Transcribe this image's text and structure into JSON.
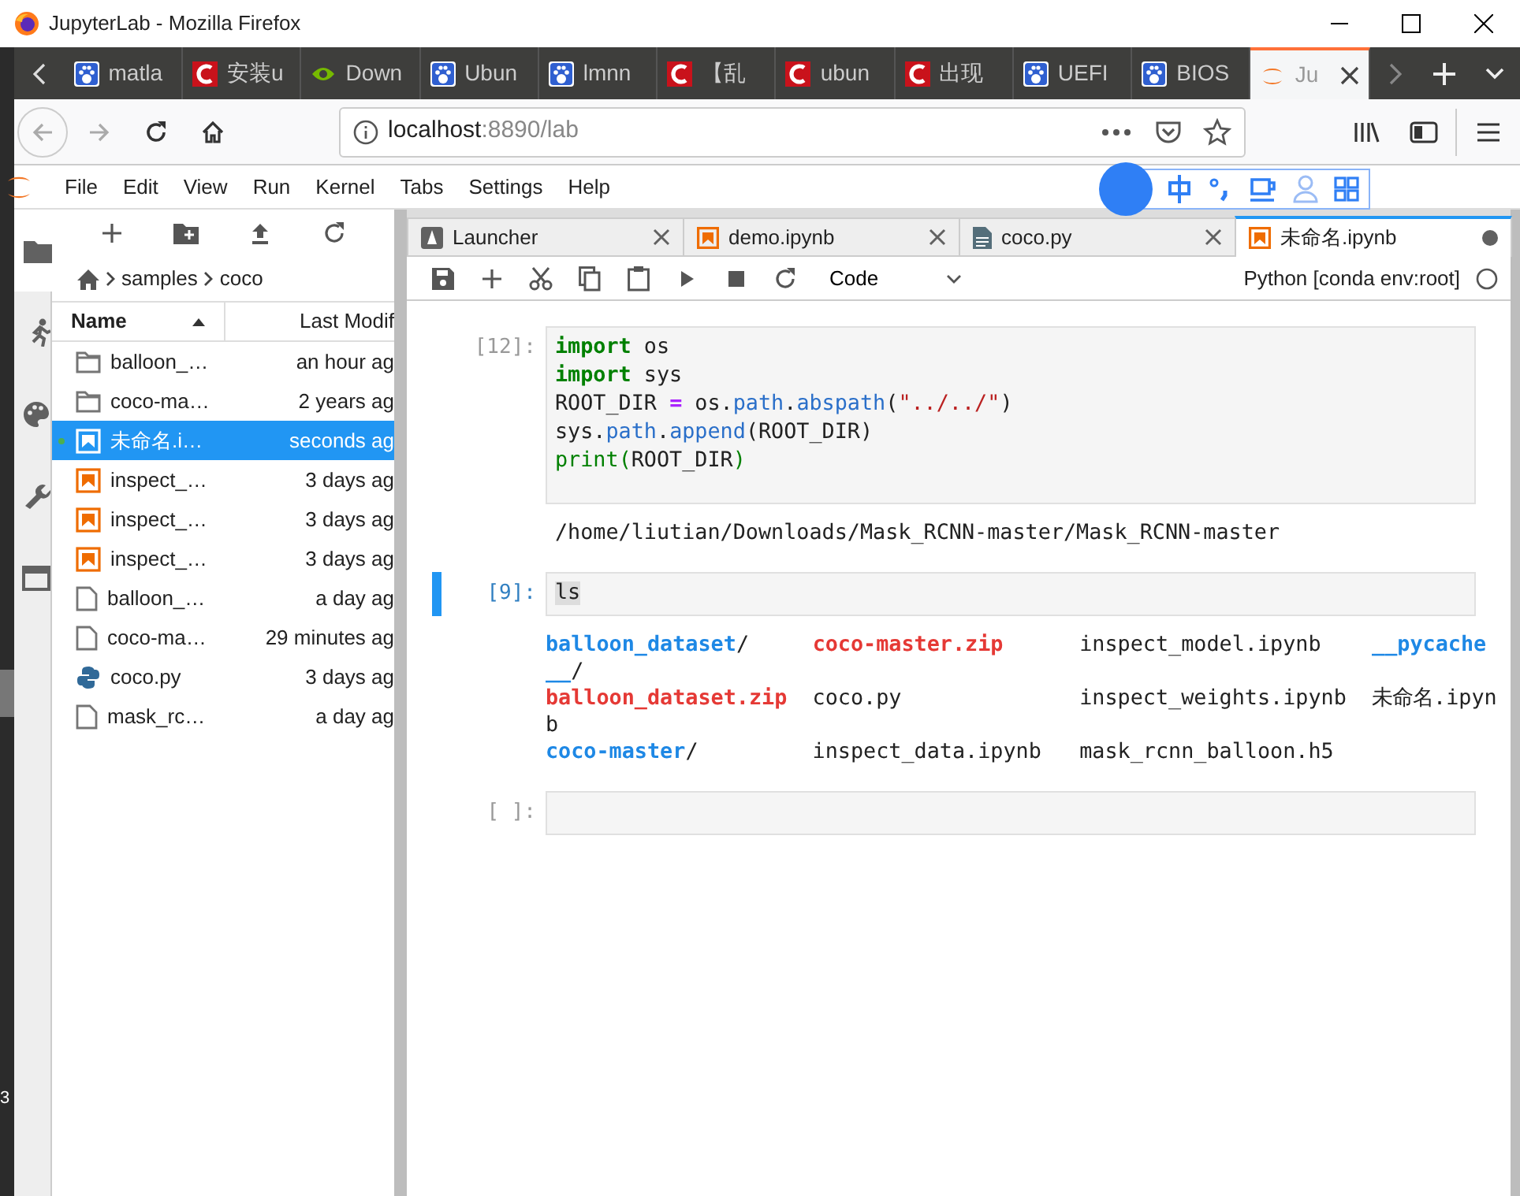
{
  "window": {
    "title": "JupyterLab - Mozilla Firefox"
  },
  "browser_tabs": [
    {
      "label": "matla",
      "kind": "baidu",
      "selected": false
    },
    {
      "label": "安装u",
      "kind": "csdn",
      "selected": false
    },
    {
      "label": "Down",
      "kind": "nvidia",
      "selected": false
    },
    {
      "label": "Ubun",
      "kind": "baidu",
      "selected": false
    },
    {
      "label": "lmnn",
      "kind": "baidu",
      "selected": false
    },
    {
      "label": "【乱",
      "kind": "csdn",
      "selected": false
    },
    {
      "label": "ubun",
      "kind": "csdn",
      "selected": false
    },
    {
      "label": "出现",
      "kind": "csdn",
      "selected": false
    },
    {
      "label": "UEFI",
      "kind": "baidu",
      "selected": false
    },
    {
      "label": "BIOS",
      "kind": "baidu",
      "selected": false
    },
    {
      "label": "Ju",
      "kind": "jupyter",
      "selected": true
    }
  ],
  "address": {
    "host": "localhost",
    "path": ":8890/lab"
  },
  "menu": [
    "File",
    "Edit",
    "View",
    "Run",
    "Kernel",
    "Tabs",
    "Settings",
    "Help"
  ],
  "file_browser": {
    "breadcrumbs": [
      "samples",
      "coco"
    ],
    "columns": [
      {
        "label": "Name",
        "sorted_ascending": true
      },
      {
        "label": "Last Modif"
      }
    ],
    "rows": [
      {
        "name": "balloon_…",
        "modified": "an hour ag",
        "kind": "folder",
        "selected": false,
        "running": false
      },
      {
        "name": "coco-ma…",
        "modified": "2 years ag",
        "kind": "folder",
        "selected": false,
        "running": false
      },
      {
        "name": "未命名.i…",
        "modified": "seconds ag",
        "kind": "notebook",
        "selected": true,
        "running": true
      },
      {
        "name": "inspect_…",
        "modified": "3 days ag",
        "kind": "notebook",
        "selected": false,
        "running": false
      },
      {
        "name": "inspect_…",
        "modified": "3 days ag",
        "kind": "notebook",
        "selected": false,
        "running": false
      },
      {
        "name": "inspect_…",
        "modified": "3 days ag",
        "kind": "notebook",
        "selected": false,
        "running": false
      },
      {
        "name": "balloon_…",
        "modified": "a day ag",
        "kind": "file",
        "selected": false,
        "running": false
      },
      {
        "name": "coco-ma…",
        "modified": "29 minutes ag",
        "kind": "file",
        "selected": false,
        "running": false
      },
      {
        "name": "coco.py",
        "modified": "3 days ag",
        "kind": "python",
        "selected": false,
        "running": false
      },
      {
        "name": "mask_rc…",
        "modified": "a day ag",
        "kind": "file",
        "selected": false,
        "running": false
      }
    ]
  },
  "notebook_tabs": [
    {
      "label": "Launcher",
      "kind": "launcher",
      "selected": false,
      "dirty": false
    },
    {
      "label": "demo.ipynb",
      "kind": "notebook",
      "selected": false,
      "dirty": false
    },
    {
      "label": "coco.py",
      "kind": "file",
      "selected": false,
      "dirty": false
    },
    {
      "label": "未命名.ipynb",
      "kind": "notebook",
      "selected": true,
      "dirty": true
    }
  ],
  "toolbar": {
    "cell_type": "Code",
    "kernel": "Python [conda env:root]",
    "kernel_busy": false
  },
  "cells": [
    {
      "prompt": "[12]:",
      "active": false,
      "input": [
        [
          {
            "text": "import",
            "kind": "keyword"
          },
          {
            "text": " os",
            "kind": "plain"
          }
        ],
        [
          {
            "text": "import",
            "kind": "keyword"
          },
          {
            "text": " sys",
            "kind": "plain"
          }
        ],
        [
          {
            "text": "ROOT_DIR ",
            "kind": "plain"
          },
          {
            "text": "=",
            "kind": "op"
          },
          {
            "text": " os.",
            "kind": "plain"
          },
          {
            "text": "path",
            "kind": "attr"
          },
          {
            "text": ".",
            "kind": "plain"
          },
          {
            "text": "abspath",
            "kind": "attr"
          },
          {
            "text": "(",
            "kind": "plain"
          },
          {
            "text": "\"../../\"",
            "kind": "string"
          },
          {
            "text": ")",
            "kind": "plain"
          }
        ],
        [
          {
            "text": "sys.",
            "kind": "plain"
          },
          {
            "text": "path",
            "kind": "attr"
          },
          {
            "text": ".",
            "kind": "plain"
          },
          {
            "text": "append",
            "kind": "attr"
          },
          {
            "text": "(ROOT_DIR)",
            "kind": "plain"
          }
        ],
        [
          {
            "text": "print",
            "kind": "builtin"
          },
          {
            "text": "(",
            "kind": "builtin"
          },
          {
            "text": "ROOT_DIR",
            "kind": "plain"
          },
          {
            "text": ")",
            "kind": "builtin"
          }
        ]
      ],
      "output": [
        [
          {
            "text": "/home/liutian/Downloads/Mask_RCNN-master/Mask_RCNN-master",
            "kind": "plain"
          }
        ]
      ]
    },
    {
      "prompt": "[9]:",
      "active": true,
      "input": [
        [
          {
            "text": "ls",
            "kind": "highlight"
          }
        ]
      ],
      "output": [
        [
          {
            "text": "balloon_dataset",
            "kind": "dir"
          },
          {
            "text": "/     ",
            "kind": "plain"
          },
          {
            "text": "coco-master.zip",
            "kind": "zip"
          },
          {
            "text": "      inspect_model.ipynb    ",
            "kind": "plain"
          },
          {
            "text": "__pycache",
            "kind": "dir"
          }
        ],
        [
          {
            "text": "__",
            "kind": "dir"
          },
          {
            "text": "/",
            "kind": "plain"
          }
        ],
        [
          {
            "text": "balloon_dataset.zip",
            "kind": "zip"
          },
          {
            "text": "  coco.py              inspect_weights.ipynb  未命名.ipyn",
            "kind": "plain"
          }
        ],
        [
          {
            "text": "b",
            "kind": "plain"
          }
        ],
        [
          {
            "text": "coco-master",
            "kind": "dir"
          },
          {
            "text": "/         inspect_data.ipynb   mask_rcnn_balloon.h5",
            "kind": "plain"
          }
        ]
      ]
    },
    {
      "prompt": "[ ]:",
      "active": false
    }
  ],
  "desktop_edge_text": "3"
}
